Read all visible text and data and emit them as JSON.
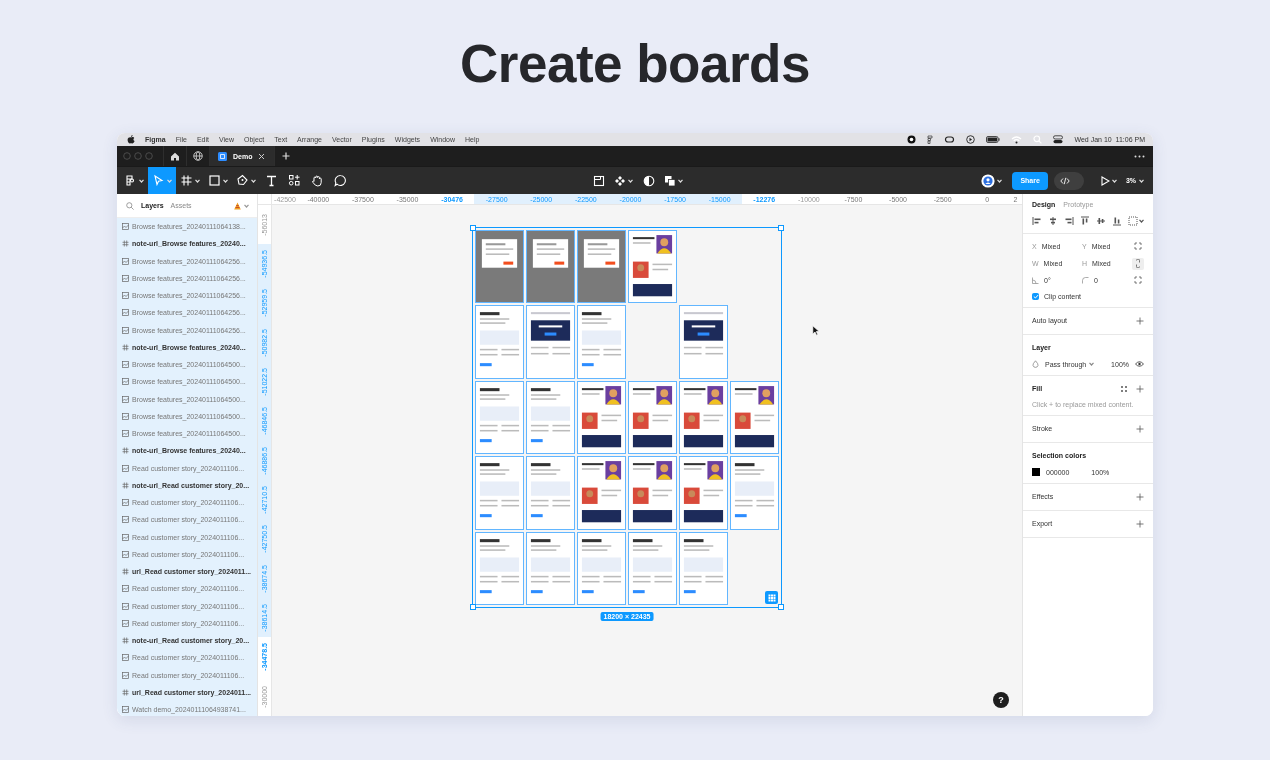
{
  "headline": "Create boards",
  "menu_bar": {
    "app": "Figma",
    "items": [
      "File",
      "Edit",
      "View",
      "Object",
      "Text",
      "Arrange",
      "Vector",
      "Plugins",
      "Widgets",
      "Window",
      "Help"
    ],
    "clock": "Wed Jan 10  11:06 PM"
  },
  "tabs": [
    {
      "label": "Demo",
      "selected": true
    }
  ],
  "toolbar": {
    "tools": [
      {
        "kind": "main-menu",
        "selected": false
      },
      {
        "kind": "move",
        "selected": true
      },
      {
        "kind": "frame",
        "selected": false
      },
      {
        "kind": "shape",
        "selected": false
      },
      {
        "kind": "pen",
        "selected": false
      },
      {
        "kind": "text",
        "selected": false
      },
      {
        "kind": "resources",
        "selected": false
      },
      {
        "kind": "hand",
        "selected": false
      },
      {
        "kind": "comment",
        "selected": false
      }
    ],
    "share": "Share",
    "dev_mode": {
      "on": false
    },
    "zoom": "3%"
  },
  "layers_panel": {
    "tabs": [
      {
        "label": "Layers",
        "selected": true
      },
      {
        "label": "Assets",
        "selected": false
      }
    ],
    "layers": [
      {
        "name": "Browse features_20240111064138...",
        "kind": "image",
        "selected": true
      },
      {
        "name": "note-url_Browse features_20240...",
        "kind": "frame",
        "selected": true
      },
      {
        "name": "Browse features_20240111064256...",
        "kind": "image",
        "selected": true
      },
      {
        "name": "Browse features_20240111064256...",
        "kind": "image",
        "selected": true
      },
      {
        "name": "Browse features_20240111064256...",
        "kind": "image",
        "selected": true
      },
      {
        "name": "Browse features_20240111064256...",
        "kind": "image",
        "selected": true
      },
      {
        "name": "Browse features_20240111064256...",
        "kind": "image",
        "selected": true
      },
      {
        "name": "note-url_Browse features_20240...",
        "kind": "frame",
        "selected": true
      },
      {
        "name": "Browse features_20240111064500...",
        "kind": "image",
        "selected": true
      },
      {
        "name": "Browse features_20240111064500...",
        "kind": "image",
        "selected": true
      },
      {
        "name": "Browse features_20240111064500...",
        "kind": "image",
        "selected": true
      },
      {
        "name": "Browse features_20240111064500...",
        "kind": "image",
        "selected": true
      },
      {
        "name": "Browse features_20240111064500...",
        "kind": "image",
        "selected": true
      },
      {
        "name": "note-url_Browse features_20240...",
        "kind": "frame",
        "selected": true
      },
      {
        "name": "Read customer story_2024011106...",
        "kind": "image",
        "selected": true
      },
      {
        "name": "note-url_Read customer story_20...",
        "kind": "frame",
        "selected": true
      },
      {
        "name": "Read customer story_2024011106...",
        "kind": "image",
        "selected": true
      },
      {
        "name": "Read customer story_2024011106...",
        "kind": "image",
        "selected": true
      },
      {
        "name": "Read customer story_2024011106...",
        "kind": "image",
        "selected": true
      },
      {
        "name": "Read customer story_2024011106...",
        "kind": "image",
        "selected": true
      },
      {
        "name": "url_Read customer story_2024011...",
        "kind": "frame",
        "selected": true
      },
      {
        "name": "Read customer story_2024011106...",
        "kind": "image",
        "selected": true
      },
      {
        "name": "Read customer story_2024011106...",
        "kind": "image",
        "selected": true
      },
      {
        "name": "Read customer story_2024011106...",
        "kind": "image",
        "selected": true
      },
      {
        "name": "note-url_Read customer story_20...",
        "kind": "frame",
        "selected": true
      },
      {
        "name": "Read customer story_2024011106...",
        "kind": "image",
        "selected": true
      },
      {
        "name": "Read customer story_2024011106...",
        "kind": "image",
        "selected": true
      },
      {
        "name": "url_Read customer story_2024011...",
        "kind": "frame",
        "selected": true
      },
      {
        "name": "Watch demo_20240111064938741...",
        "kind": "image",
        "selected": true
      }
    ]
  },
  "ruler_h": [
    {
      "label": "-42500",
      "kind": "faded"
    },
    {
      "label": "-40000",
      "kind": "tick"
    },
    {
      "label": "-37500",
      "kind": "tick"
    },
    {
      "label": "-35000",
      "kind": "tick"
    },
    {
      "label": "-30476",
      "kind": "edge"
    },
    {
      "label": "-27500",
      "kind": "band"
    },
    {
      "label": "-25000",
      "kind": "band"
    },
    {
      "label": "-22500",
      "kind": "band"
    },
    {
      "label": "-20000",
      "kind": "band"
    },
    {
      "label": "-17500",
      "kind": "band"
    },
    {
      "label": "-15000",
      "kind": "band"
    },
    {
      "label": "-12276",
      "kind": "edge"
    },
    {
      "label": "-10000",
      "kind": "faded"
    },
    {
      "label": "-7500",
      "kind": "tick"
    },
    {
      "label": "-5000",
      "kind": "tick"
    },
    {
      "label": "-2500",
      "kind": "tick"
    },
    {
      "label": "0",
      "kind": "tick"
    },
    {
      "label": "2",
      "kind": "tick"
    }
  ],
  "ruler_v": [
    {
      "label": "-56013",
      "kind": "faded"
    },
    {
      "label": "-54936.5",
      "kind": "band"
    },
    {
      "label": "-52959.5",
      "kind": "band"
    },
    {
      "label": "-50982.5",
      "kind": "band"
    },
    {
      "label": "-51022.5",
      "kind": "band"
    },
    {
      "label": "-46846.5",
      "kind": "band"
    },
    {
      "label": "-46886.5",
      "kind": "band"
    },
    {
      "label": "-42710.5",
      "kind": "band"
    },
    {
      "label": "-42750.5",
      "kind": "band"
    },
    {
      "label": "-38674.5",
      "kind": "band"
    },
    {
      "label": "-38614.5",
      "kind": "band"
    },
    {
      "label": "-34478.5",
      "kind": "edge"
    },
    {
      "label": "-30000",
      "kind": "faded"
    }
  ],
  "canvas": {
    "board_rows": [
      [
        {
          "kind": "gray"
        },
        {
          "kind": "gray"
        },
        {
          "kind": "gray"
        },
        {
          "kind": "photo"
        },
        {
          "kind": "empty"
        },
        {
          "kind": "empty"
        }
      ],
      [
        {
          "kind": "page"
        },
        {
          "kind": "navy"
        },
        {
          "kind": "page"
        },
        {
          "kind": "empty"
        },
        {
          "kind": "navy"
        },
        {
          "kind": "empty"
        }
      ],
      [
        {
          "kind": "page"
        },
        {
          "kind": "page"
        },
        {
          "kind": "photo"
        },
        {
          "kind": "photo"
        },
        {
          "kind": "photo"
        },
        {
          "kind": "photo"
        }
      ],
      [
        {
          "kind": "page"
        },
        {
          "kind": "page"
        },
        {
          "kind": "photo"
        },
        {
          "kind": "photo"
        },
        {
          "kind": "photo"
        },
        {
          "kind": "page"
        }
      ],
      [
        {
          "kind": "page"
        },
        {
          "kind": "page"
        },
        {
          "kind": "page"
        },
        {
          "kind": "page"
        },
        {
          "kind": "page"
        },
        {
          "kind": "empty"
        }
      ]
    ],
    "selection_size": "18200 × 22435",
    "help": "?"
  },
  "design_panel": {
    "tabs": [
      {
        "label": "Design",
        "selected": true
      },
      {
        "label": "Prototype",
        "selected": false
      }
    ],
    "fields": [
      {
        "kind": "text",
        "label": "X",
        "value": "Mixed"
      },
      {
        "kind": "text",
        "label": "Y",
        "value": "Mixed"
      },
      {
        "kind": "text",
        "label": "W",
        "value": "Mixed"
      },
      {
        "kind": "text",
        "label": "H",
        "value": "Mixed"
      },
      {
        "kind": "rotation",
        "value": "0°"
      },
      {
        "kind": "radius",
        "value": "0"
      }
    ],
    "clip_content": {
      "label": "Clip content",
      "checked": true
    },
    "sections": [
      {
        "kind": "empty",
        "title": "Auto layout"
      },
      {
        "kind": "layer",
        "title": "Layer",
        "blend": "Pass through",
        "opacity": "100%"
      },
      {
        "kind": "fill",
        "title": "Fill",
        "note": "Click + to replace mixed content."
      },
      {
        "kind": "empty",
        "title": "Stroke"
      },
      {
        "kind": "colors",
        "title": "Selection colors",
        "color": "#000000",
        "hex": "000000",
        "opacity": "100%"
      },
      {
        "kind": "empty",
        "title": "Effects"
      },
      {
        "kind": "empty",
        "title": "Export"
      }
    ]
  }
}
